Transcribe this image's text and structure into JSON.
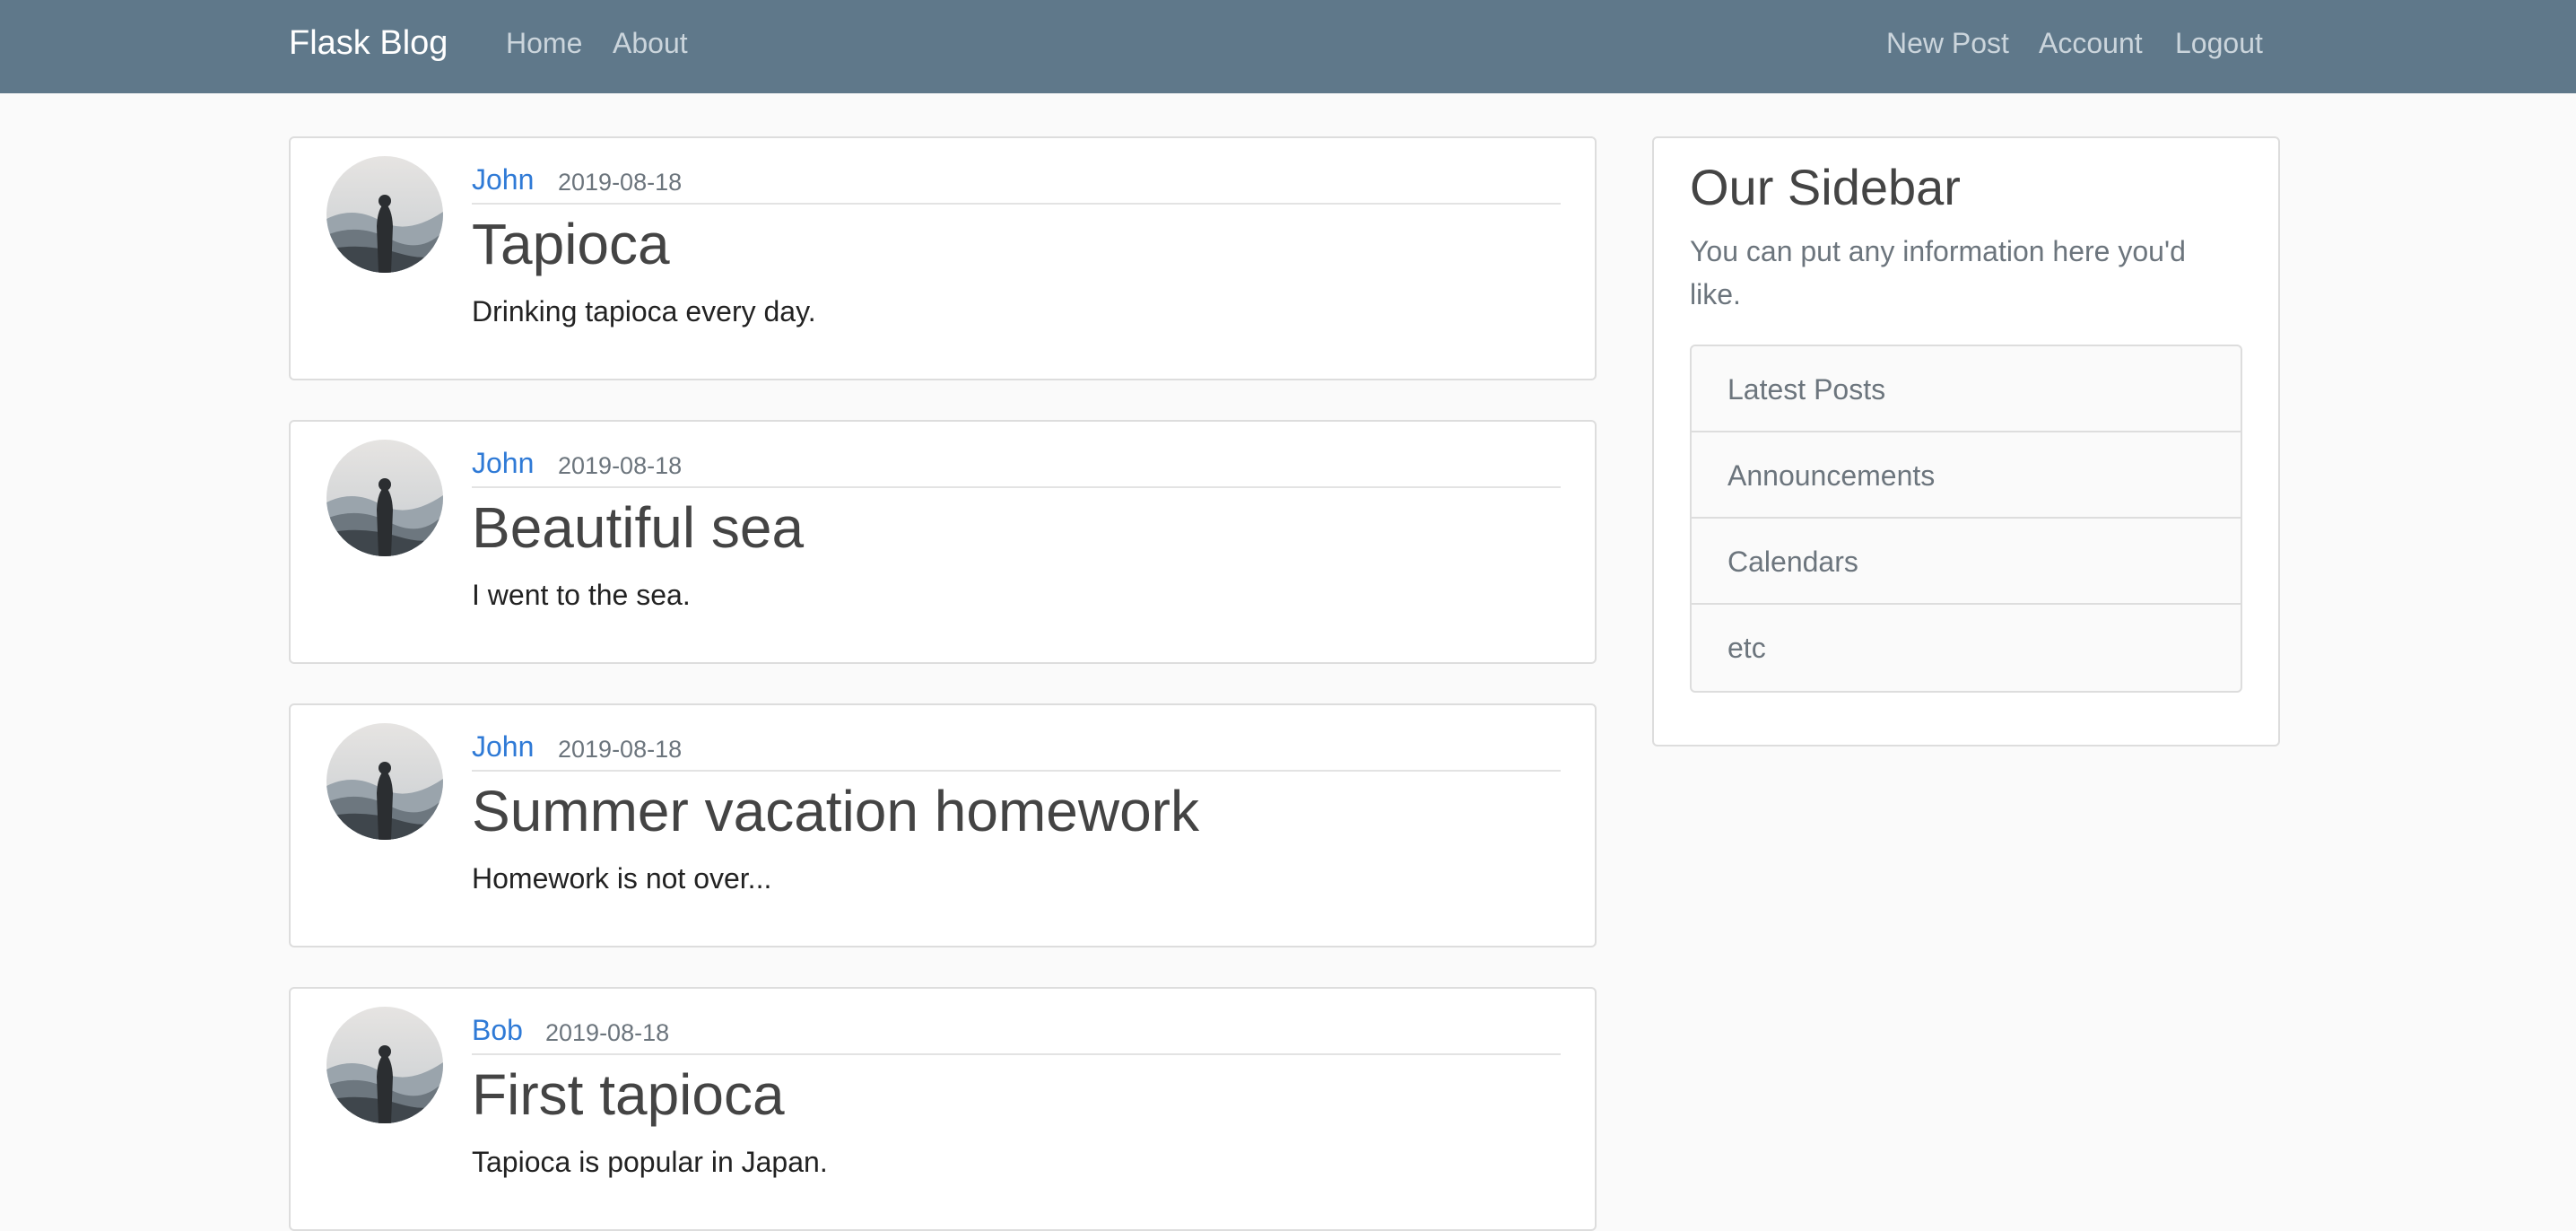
{
  "navbar": {
    "brand": "Flask Blog",
    "left_links": [
      "Home",
      "About"
    ],
    "right_links": [
      "New Post",
      "Account",
      "Logout"
    ],
    "background_color": "#5f788a"
  },
  "posts": [
    {
      "author": "John",
      "date": "2019-08-18",
      "title": "Tapioca",
      "content": "Drinking tapioca every day."
    },
    {
      "author": "John",
      "date": "2019-08-18",
      "title": "Beautiful sea",
      "content": "I went to the sea."
    },
    {
      "author": "John",
      "date": "2019-08-18",
      "title": "Summer vacation homework",
      "content": "Homework is not over..."
    },
    {
      "author": "Bob",
      "date": "2019-08-18",
      "title": "First tapioca",
      "content": "Tapioca is popular in Japan."
    }
  ],
  "sidebar": {
    "title": "Our Sidebar",
    "description": "You can put any information here you'd like.",
    "items": [
      "Latest Posts",
      "Announcements",
      "Calendars",
      "etc"
    ]
  },
  "colors": {
    "link": "#2f7ad6",
    "page_background": "#fafafa"
  }
}
